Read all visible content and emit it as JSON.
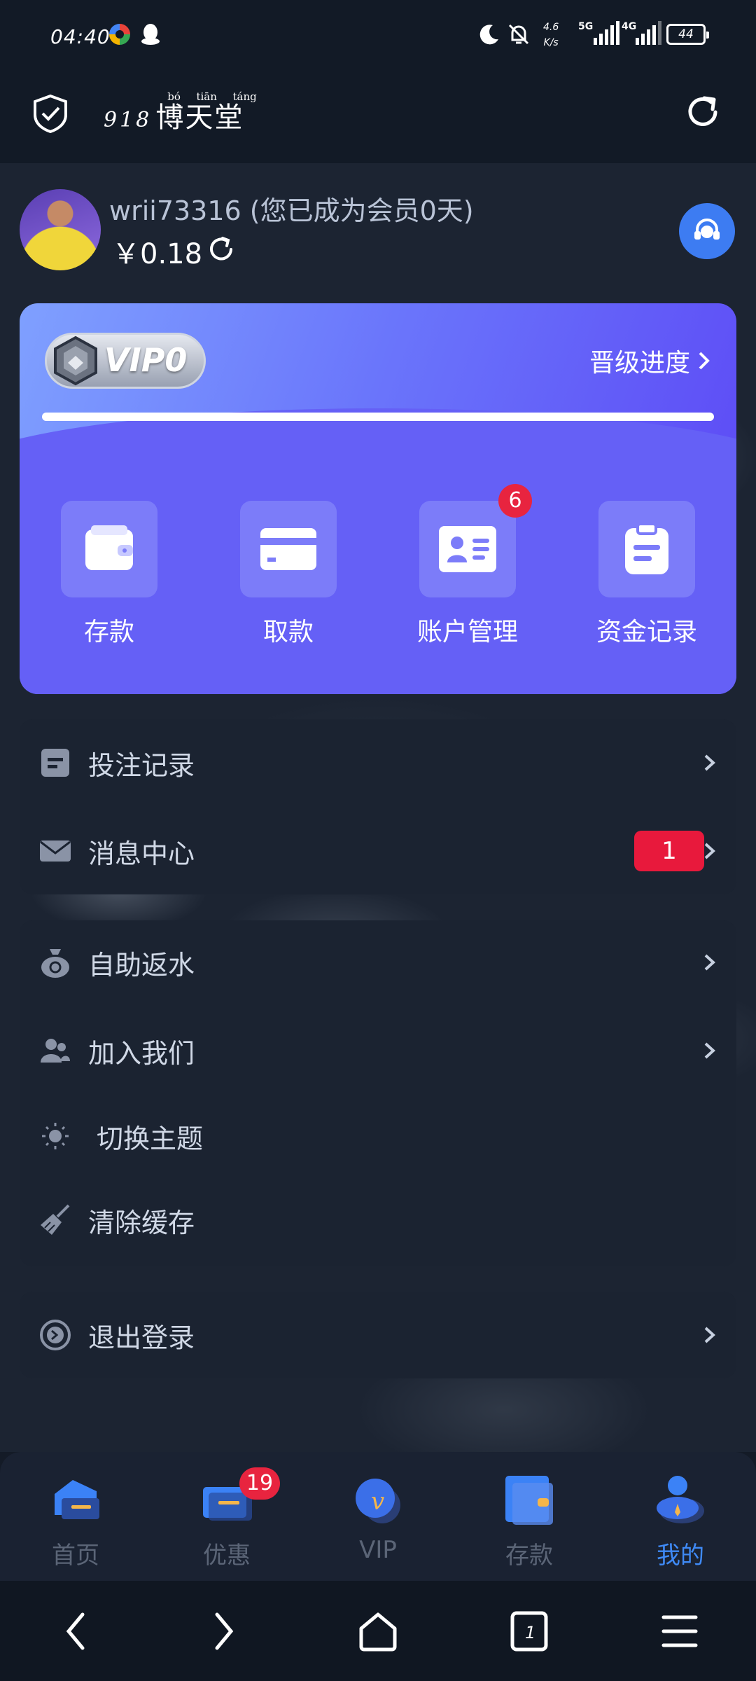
{
  "status_bar": {
    "time": "04:40",
    "net_speed": "4.6",
    "net_unit": "K/s",
    "signal_1": "5G",
    "signal_2": "4G",
    "battery": "44"
  },
  "app": {
    "logo_digits": "918",
    "logo_text": "博天堂",
    "logo_pinyin": [
      "bó",
      "tiān",
      "táng"
    ]
  },
  "user": {
    "username": "wrii73316 (您已成为会员0天)",
    "balance": "￥0.18"
  },
  "vip": {
    "level": "VIP0",
    "progress_label": "晋级进度",
    "progress": 1.0
  },
  "actions": [
    {
      "label": "存款",
      "icon": "wallet-icon"
    },
    {
      "label": "取款",
      "icon": "card-icon"
    },
    {
      "label": "账户管理",
      "icon": "id-card-icon",
      "badge": "6"
    },
    {
      "label": "资金记录",
      "icon": "clipboard-icon"
    }
  ],
  "menu1": [
    {
      "label": "投注记录",
      "icon": "document-icon"
    },
    {
      "label": "消息中心",
      "icon": "mail-icon",
      "badge": "1"
    }
  ],
  "menu2": [
    {
      "label": "自助返水",
      "icon": "money-bag-icon"
    },
    {
      "label": "加入我们",
      "icon": "users-icon"
    },
    {
      "label": "切换主题",
      "icon": "sun-icon"
    },
    {
      "label": "清除缓存",
      "icon": "broom-icon"
    }
  ],
  "menu3": [
    {
      "label": "退出登录",
      "icon": "logout-icon"
    }
  ],
  "tabs": [
    {
      "label": "首页",
      "icon": "home-icon"
    },
    {
      "label": "优惠",
      "icon": "promo-icon",
      "badge": "19"
    },
    {
      "label": "VIP",
      "icon": "vip-icon"
    },
    {
      "label": "存款",
      "icon": "deposit-icon"
    },
    {
      "label": "我的",
      "icon": "profile-icon",
      "active": true
    }
  ],
  "system_nav": {
    "tab_count": "1"
  },
  "colors": {
    "accent": "#3f8af6",
    "vip_gradient_start": "#7fa0ff",
    "vip_gradient_end": "#5b45f5",
    "badge": "#e8243f",
    "panel": "#1b2331"
  }
}
